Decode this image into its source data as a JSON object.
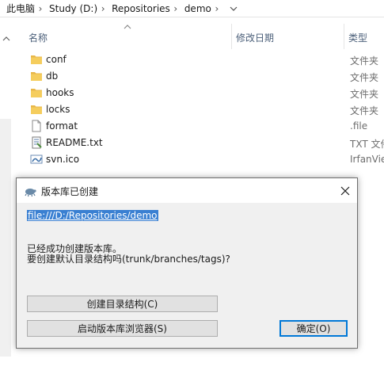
{
  "breadcrumb": {
    "items": [
      "此电脑",
      "Study (D:)",
      "Repositories",
      "demo"
    ]
  },
  "columns": {
    "name": "名称",
    "date_modified": "修改日期",
    "type": "类型"
  },
  "files": [
    {
      "name": "conf",
      "type": "文件夹",
      "icon": "folder-icon"
    },
    {
      "name": "db",
      "type": "文件夹",
      "icon": "folder-icon"
    },
    {
      "name": "hooks",
      "type": "文件夹",
      "icon": "folder-icon"
    },
    {
      "name": "locks",
      "type": "文件夹",
      "icon": "folder-icon"
    },
    {
      "name": "format",
      "type": ".file",
      "icon": "file-icon"
    },
    {
      "name": "README.txt",
      "type": "TXT 文件",
      "icon": "text-file-icon"
    },
    {
      "name": "svn.ico",
      "type": "IrfanView",
      "icon": "ico-file-icon"
    }
  ],
  "dialog": {
    "title": "版本库已创建",
    "url": "file:///D:/Repositories/demo",
    "message_line1": "已经成功创建版本库。",
    "message_line2": "要创建默认目录结构吗(trunk/branches/tags)?",
    "create_structure_label": "创建目录结构(C)",
    "start_browser_label": "启动版本库浏览器(S)",
    "ok_label": "确定(O)"
  },
  "colors": {
    "folder": "#e8b74a",
    "accent": "#0078d7",
    "link_highlight": "#3a80d2",
    "header_text": "#4c607a"
  }
}
